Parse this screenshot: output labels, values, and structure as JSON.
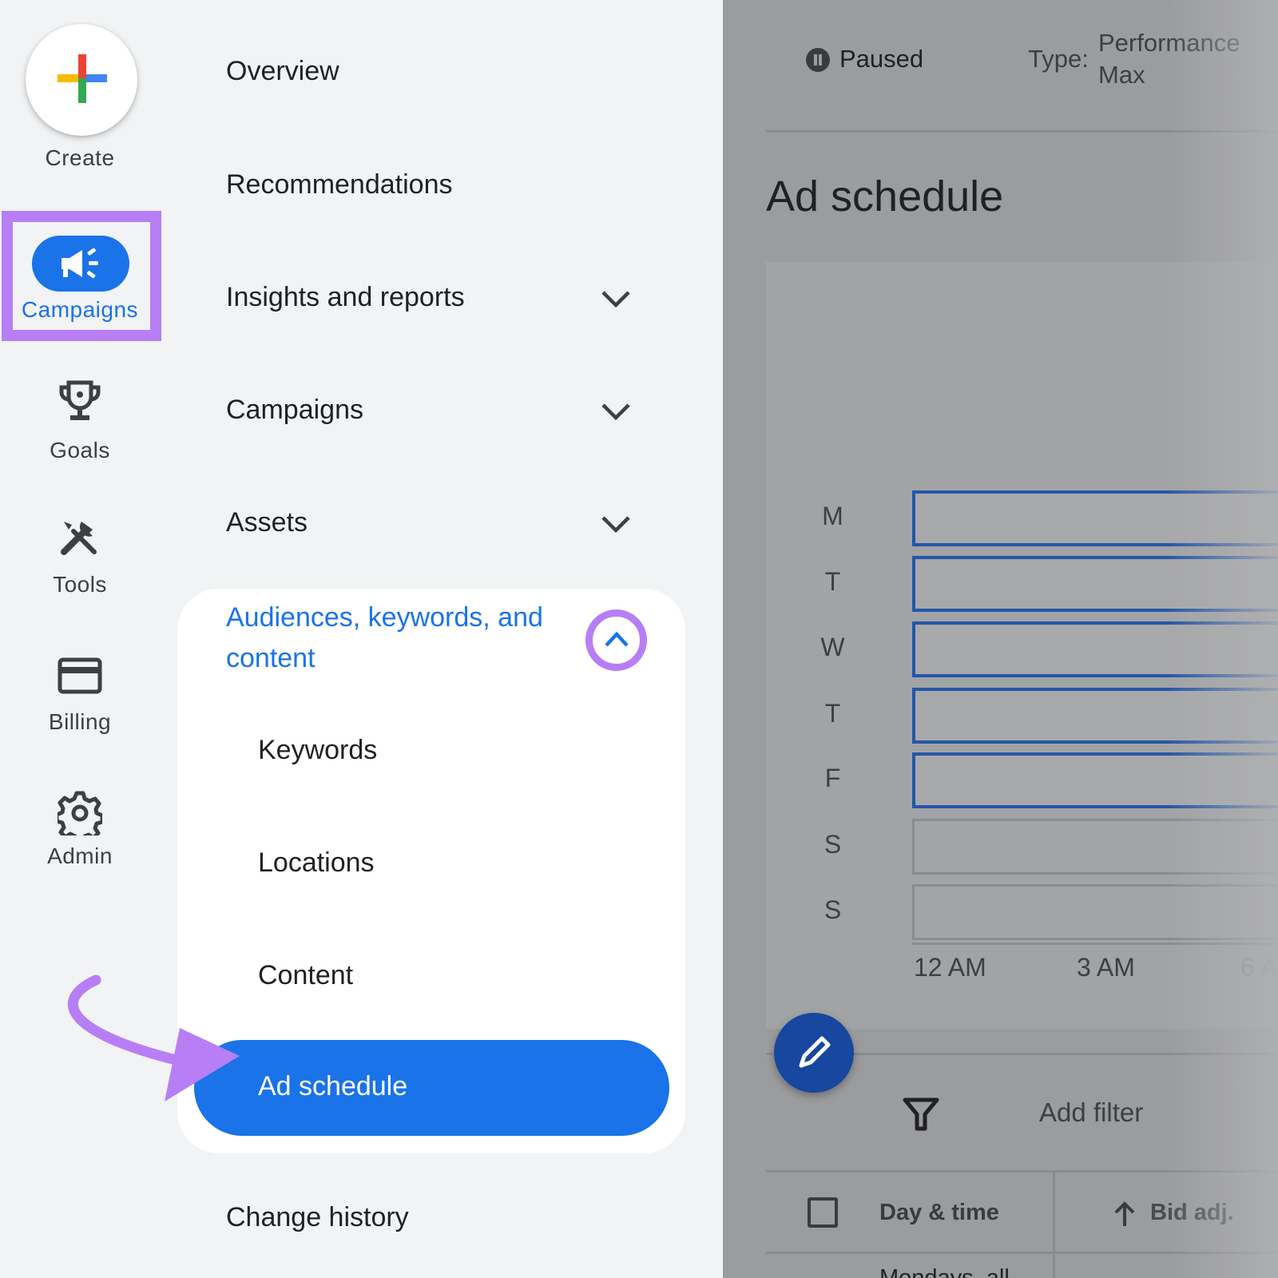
{
  "rail": {
    "create": "Create",
    "campaigns": "Campaigns",
    "goals": "Goals",
    "tools": "Tools",
    "billing": "Billing",
    "admin": "Admin"
  },
  "nav": {
    "overview": "Overview",
    "recommendations": "Recommendations",
    "insights": "Insights and reports",
    "campaigns": "Campaigns",
    "assets": "Assets",
    "section_title": "Audiences, keywords, and content",
    "sub_items": [
      "Keywords",
      "Locations",
      "Content"
    ],
    "active_item": "Ad schedule",
    "change_history": "Change history"
  },
  "campaign": {
    "status": "Paused",
    "type_label": "Type:",
    "type_value_line1": "Performance",
    "type_value_line2": "Max"
  },
  "schedule": {
    "title": "Ad schedule",
    "days": [
      "M",
      "T",
      "W",
      "T",
      "F",
      "S",
      "S"
    ],
    "active_days": [
      true,
      true,
      true,
      true,
      true,
      false,
      false
    ],
    "time_ticks": [
      "12 AM",
      "3 AM",
      "6 A"
    ]
  },
  "table": {
    "add_filter": "Add filter",
    "col_day_time": "Day & time",
    "col_bid_adj": "Bid adj.",
    "first_row_partial": "Mondays, all"
  },
  "colors": {
    "accent": "#1a73e8",
    "highlight": "#b77ef5",
    "overlay": "#9b9c9e"
  }
}
